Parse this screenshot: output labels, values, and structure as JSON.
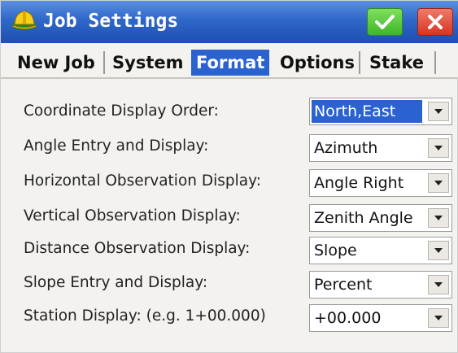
{
  "window": {
    "title": "Job Settings",
    "ok_icon": "checkmark-icon",
    "close_icon": "close-icon",
    "app_icon": "hardhat-icon"
  },
  "tabs": [
    {
      "label": "New Job",
      "active": false
    },
    {
      "label": "System",
      "active": false
    },
    {
      "label": "Format",
      "active": true
    },
    {
      "label": "Options",
      "active": false
    },
    {
      "label": "Stake",
      "active": false
    }
  ],
  "settings": [
    {
      "label": "Coordinate Display Order:",
      "value": "North,East",
      "selected": true
    },
    {
      "label": "Angle Entry and Display:",
      "value": "Azimuth",
      "selected": false
    },
    {
      "label": "Horizontal Observation Display:",
      "value": "Angle Right",
      "selected": false
    },
    {
      "label": "Vertical Observation Display:",
      "value": "Zenith Angle",
      "selected": false
    },
    {
      "label": "Distance Observation Display:",
      "value": "Slope",
      "selected": false
    },
    {
      "label": "Slope Entry and Display:",
      "value": "Percent",
      "selected": false
    },
    {
      "label": "Station Display: (e.g. 1+00.000)",
      "value": "+00.000",
      "selected": false
    }
  ],
  "colors": {
    "titlebar": "#2f67c9",
    "accent": "#2a62d0",
    "ok": "#3fb52a",
    "close": "#d8341f"
  }
}
